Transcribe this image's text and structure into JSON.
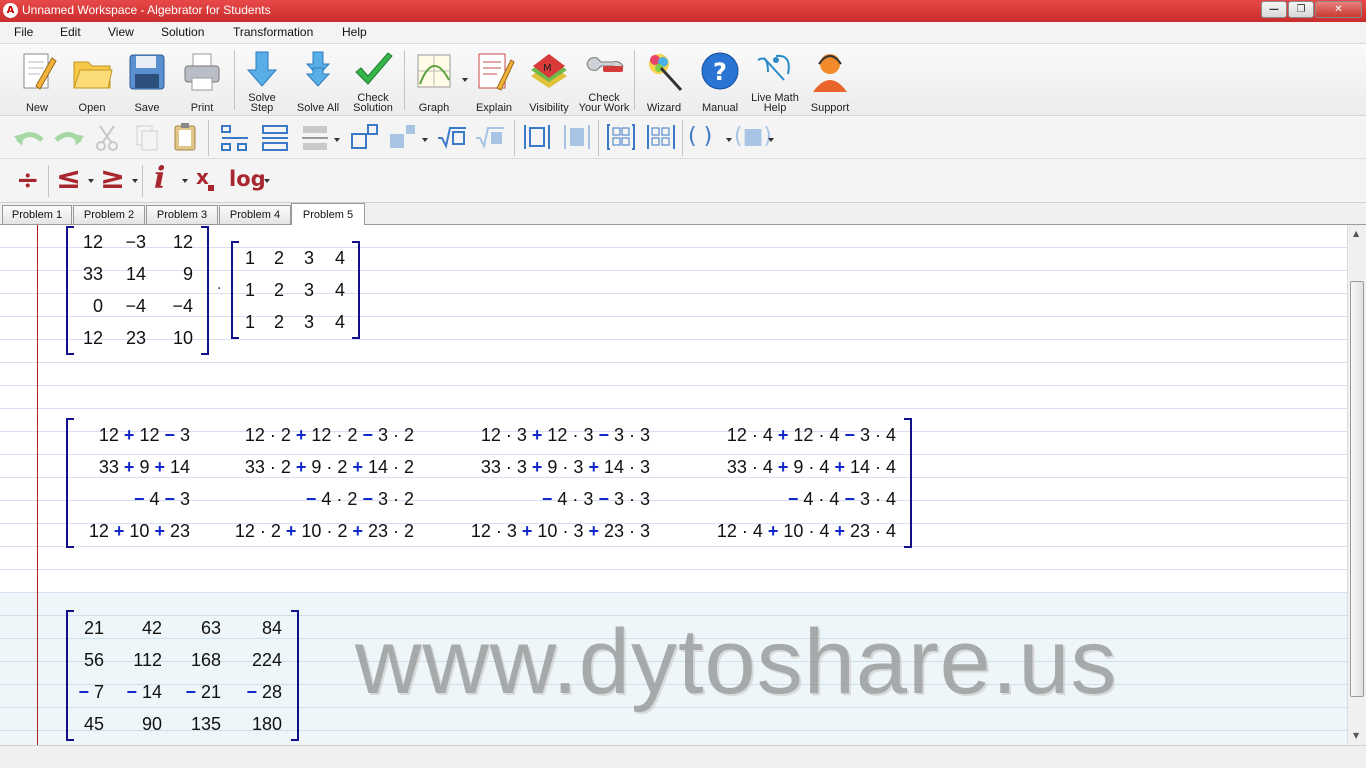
{
  "window": {
    "title": "Unnamed Workspace - Algebrator for Students",
    "app_icon_letter": "A",
    "controls": [
      "minimize",
      "maximize",
      "close"
    ]
  },
  "menu": [
    "File",
    "Edit",
    "View",
    "Solution",
    "Transformation",
    "Help"
  ],
  "toolbar": {
    "new": "New",
    "open": "Open",
    "save": "Save",
    "print": "Print",
    "solve_step": "Solve Step",
    "solve_all": "Solve All",
    "check_solution": "Check Solution",
    "graph": "Graph",
    "explain": "Explain",
    "visibility": "Visibility",
    "check_work": "Check Your Work",
    "wizard": "Wizard",
    "manual": "Manual",
    "live_help": "Live Math Help",
    "support": "Support"
  },
  "math_toolbar": {
    "divide": "÷",
    "le": "≤",
    "ge": "≥",
    "imag": "i",
    "subscript": "x",
    "log": "log"
  },
  "tabs": [
    {
      "label": "Problem 1",
      "active": false
    },
    {
      "label": "Problem 2",
      "active": false
    },
    {
      "label": "Problem 3",
      "active": false
    },
    {
      "label": "Problem 4",
      "active": false
    },
    {
      "label": "Problem 5",
      "active": true
    }
  ],
  "matrix_a": [
    [
      "12",
      "−3",
      "12"
    ],
    [
      "33",
      "14",
      "9"
    ],
    [
      "0",
      "−4",
      "−4"
    ],
    [
      "12",
      "23",
      "10"
    ]
  ],
  "matrix_b": [
    [
      "1",
      "2",
      "3",
      "4"
    ],
    [
      "1",
      "2",
      "3",
      "4"
    ],
    [
      "1",
      "2",
      "3",
      "4"
    ]
  ],
  "dot_operator": "·",
  "product_expansion": [
    [
      "12 + 12 − 3",
      "12 · 2 + 12 · 2 − 3 · 2",
      "12 · 3 + 12 · 3 − 3 · 3",
      "12 · 4 + 12 · 4 − 3 · 4"
    ],
    [
      "33 + 9 + 14",
      "33 · 2 + 9 · 2 + 14 · 2",
      "33 · 3 + 9 · 3 + 14 · 3",
      "33 · 4 + 9 · 4 + 14 · 4"
    ],
    [
      "− 4 − 3",
      "− 4 · 2 − 3 · 2",
      "− 4 · 3 − 3 · 3",
      "− 4 · 4 − 3 · 4"
    ],
    [
      "12 + 10 + 23",
      "12 · 2 + 10 · 2 + 23 · 2",
      "12 · 3 + 10 · 3 + 23 · 3",
      "12 · 4 + 10 · 4 + 23 · 4"
    ]
  ],
  "result_matrix": [
    [
      "21",
      "42",
      "63",
      "84"
    ],
    [
      "56",
      "112",
      "168",
      "224"
    ],
    [
      "− 7",
      "− 14",
      "− 21",
      "− 28"
    ],
    [
      "45",
      "90",
      "135",
      "180"
    ]
  ],
  "watermark": "www.dytoshare.us",
  "colors": {
    "titlebar": "#d63a3a",
    "matrix_bracket": "#10108a",
    "operator_blue": "#1028c8",
    "margin_line": "#b02020"
  }
}
